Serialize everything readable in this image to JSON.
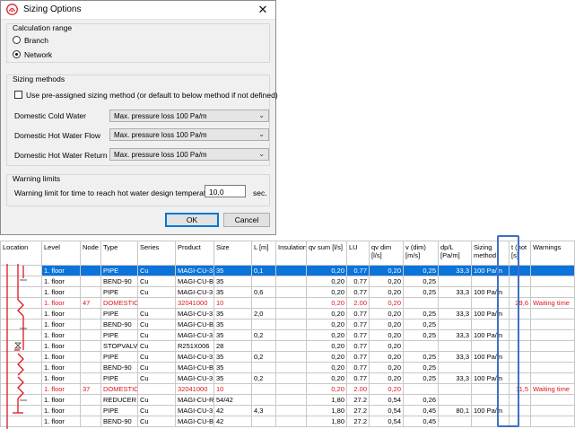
{
  "dialog": {
    "title": "Sizing Options",
    "close_glyph": "✕",
    "calc_range": {
      "title": "Calculation range",
      "options": [
        "Branch",
        "Network"
      ],
      "selected": "Network"
    },
    "sizing_methods": {
      "title": "Sizing methods",
      "checkbox_label": "Use pre-assigned sizing method (or default to below method if not defined)",
      "checked": false,
      "rows": [
        {
          "label": "Domestic Cold Water",
          "value": "Max. pressure loss 100 Pa/m"
        },
        {
          "label": "Domestic Hot Water Flow",
          "value": "Max. pressure loss 100 Pa/m"
        },
        {
          "label": "Domestic Hot Water Return",
          "value": "Max. pressure loss 100 Pa/m"
        }
      ]
    },
    "warning": {
      "title": "Warning limits",
      "label": "Warning limit for time to reach hot water design temperature",
      "value": "10,0",
      "unit": "sec."
    },
    "ok_label": "OK",
    "cancel_label": "Cancel"
  },
  "table": {
    "headers": [
      "Location",
      "Level",
      "Node",
      "Type",
      "Series",
      "Product",
      "Size",
      "L [m]",
      "Insulation",
      "qv sum [l/s]",
      "LU",
      "qv dim [l/s]",
      "v (dim) [m/s]",
      "dp/L [Pa/m]",
      "Sizing method",
      "t (hot [s]",
      "Warnings"
    ],
    "rows": [
      {
        "level": "1. floor",
        "node": "",
        "type": "PIPE",
        "series": "Cu",
        "product": "MAGI-CU-3",
        "size": "35",
        "l": "0,1",
        "ins": "",
        "qvsum": "0,20",
        "lu": "0.77",
        "qvdim": "0,20",
        "v": "0,25",
        "dpl": "33,3",
        "method": "100 Pa/m",
        "t": "",
        "warn": "",
        "style": "selected"
      },
      {
        "level": "1. floor",
        "node": "",
        "type": "BEND-90",
        "series": "Cu",
        "product": "MAGI-CU-B",
        "size": "35",
        "l": "",
        "ins": "",
        "qvsum": "0,20",
        "lu": "0.77",
        "qvdim": "0,20",
        "v": "0,25",
        "dpl": "",
        "method": "",
        "t": "",
        "warn": "",
        "style": ""
      },
      {
        "level": "1. floor",
        "node": "",
        "type": "PIPE",
        "series": "Cu",
        "product": "MAGI-CU-3",
        "size": "35",
        "l": "0,6",
        "ins": "",
        "qvsum": "0,20",
        "lu": "0.77",
        "qvdim": "0,20",
        "v": "0,25",
        "dpl": "33,3",
        "method": "100 Pa/m",
        "t": "",
        "warn": "",
        "style": ""
      },
      {
        "level": "1. floor",
        "node": "47",
        "type": "DOMESTIC",
        "series": "",
        "product": "32041000",
        "size": "10",
        "l": "",
        "ins": "",
        "qvsum": "0,20",
        "lu": "2.00",
        "qvdim": "0,20",
        "v": "",
        "dpl": "",
        "method": "",
        "t": "29,6",
        "warn": "Waiting time",
        "style": "warn"
      },
      {
        "level": "1. floor",
        "node": "",
        "type": "PIPE",
        "series": "Cu",
        "product": "MAGI-CU-3",
        "size": "35",
        "l": "2,0",
        "ins": "",
        "qvsum": "0,20",
        "lu": "0.77",
        "qvdim": "0,20",
        "v": "0,25",
        "dpl": "33,3",
        "method": "100 Pa/m",
        "t": "",
        "warn": "",
        "style": ""
      },
      {
        "level": "1. floor",
        "node": "",
        "type": "BEND-90",
        "series": "Cu",
        "product": "MAGI-CU-B",
        "size": "35",
        "l": "",
        "ins": "",
        "qvsum": "0,20",
        "lu": "0.77",
        "qvdim": "0,20",
        "v": "0,25",
        "dpl": "",
        "method": "",
        "t": "",
        "warn": "",
        "style": ""
      },
      {
        "level": "1. floor",
        "node": "",
        "type": "PIPE",
        "series": "Cu",
        "product": "MAGI-CU-3",
        "size": "35",
        "l": "0,2",
        "ins": "",
        "qvsum": "0,20",
        "lu": "0.77",
        "qvdim": "0,20",
        "v": "0,25",
        "dpl": "33,3",
        "method": "100 Pa/m",
        "t": "",
        "warn": "",
        "style": ""
      },
      {
        "level": "1. floor",
        "node": "",
        "type": "STOPVALV",
        "series": "Cu",
        "product": "R251X006",
        "size": "28",
        "l": "",
        "ins": "",
        "qvsum": "0,20",
        "lu": "0.77",
        "qvdim": "0,20",
        "v": "",
        "dpl": "",
        "method": "",
        "t": "",
        "warn": "",
        "style": ""
      },
      {
        "level": "1. floor",
        "node": "",
        "type": "PIPE",
        "series": "Cu",
        "product": "MAGI-CU-3",
        "size": "35",
        "l": "0,2",
        "ins": "",
        "qvsum": "0,20",
        "lu": "0.77",
        "qvdim": "0,20",
        "v": "0,25",
        "dpl": "33,3",
        "method": "100 Pa/m",
        "t": "",
        "warn": "",
        "style": ""
      },
      {
        "level": "1. floor",
        "node": "",
        "type": "BEND-90",
        "series": "Cu",
        "product": "MAGI-CU-B",
        "size": "35",
        "l": "",
        "ins": "",
        "qvsum": "0,20",
        "lu": "0.77",
        "qvdim": "0,20",
        "v": "0,25",
        "dpl": "",
        "method": "",
        "t": "",
        "warn": "",
        "style": ""
      },
      {
        "level": "1. floor",
        "node": "",
        "type": "PIPE",
        "series": "Cu",
        "product": "MAGI-CU-3",
        "size": "35",
        "l": "0,2",
        "ins": "",
        "qvsum": "0,20",
        "lu": "0.77",
        "qvdim": "0,20",
        "v": "0,25",
        "dpl": "33,3",
        "method": "100 Pa/m",
        "t": "",
        "warn": "",
        "style": ""
      },
      {
        "level": "1. floor",
        "node": "37",
        "type": "DOMESTIC",
        "series": "",
        "product": "32041000",
        "size": "10",
        "l": "",
        "ins": "",
        "qvsum": "0,20",
        "lu": "2.00",
        "qvdim": "0,20",
        "v": "",
        "dpl": "",
        "method": "",
        "t": "11,5",
        "warn": "Waiting time",
        "style": "warn"
      },
      {
        "level": "1. floor",
        "node": "",
        "type": "REDUCER",
        "series": "Cu",
        "product": "MAGI-CU-R",
        "size": "54/42",
        "l": "",
        "ins": "",
        "qvsum": "1,80",
        "lu": "27.2",
        "qvdim": "0,54",
        "v": "0,26",
        "dpl": "",
        "method": "",
        "t": "",
        "warn": "",
        "style": ""
      },
      {
        "level": "1. floor",
        "node": "",
        "type": "PIPE",
        "series": "Cu",
        "product": "MAGI-CU-3",
        "size": "42",
        "l": "4,3",
        "ins": "",
        "qvsum": "1,80",
        "lu": "27.2",
        "qvdim": "0,54",
        "v": "0,45",
        "dpl": "80,1",
        "method": "100 Pa/m",
        "t": "",
        "warn": "",
        "style": ""
      },
      {
        "level": "1. floor",
        "node": "",
        "type": "BEND-90",
        "series": "Cu",
        "product": "MAGI-CU-B",
        "size": "42",
        "l": "",
        "ins": "",
        "qvsum": "1,80",
        "lu": "27.2",
        "qvdim": "0,54",
        "v": "0,45",
        "dpl": "",
        "method": "",
        "t": "",
        "warn": "",
        "style": ""
      }
    ]
  },
  "colors": {
    "selection": "#0a74da",
    "warning": "#e0141e",
    "highlight": "#3f6fc4",
    "pipe": "#e0141e"
  }
}
